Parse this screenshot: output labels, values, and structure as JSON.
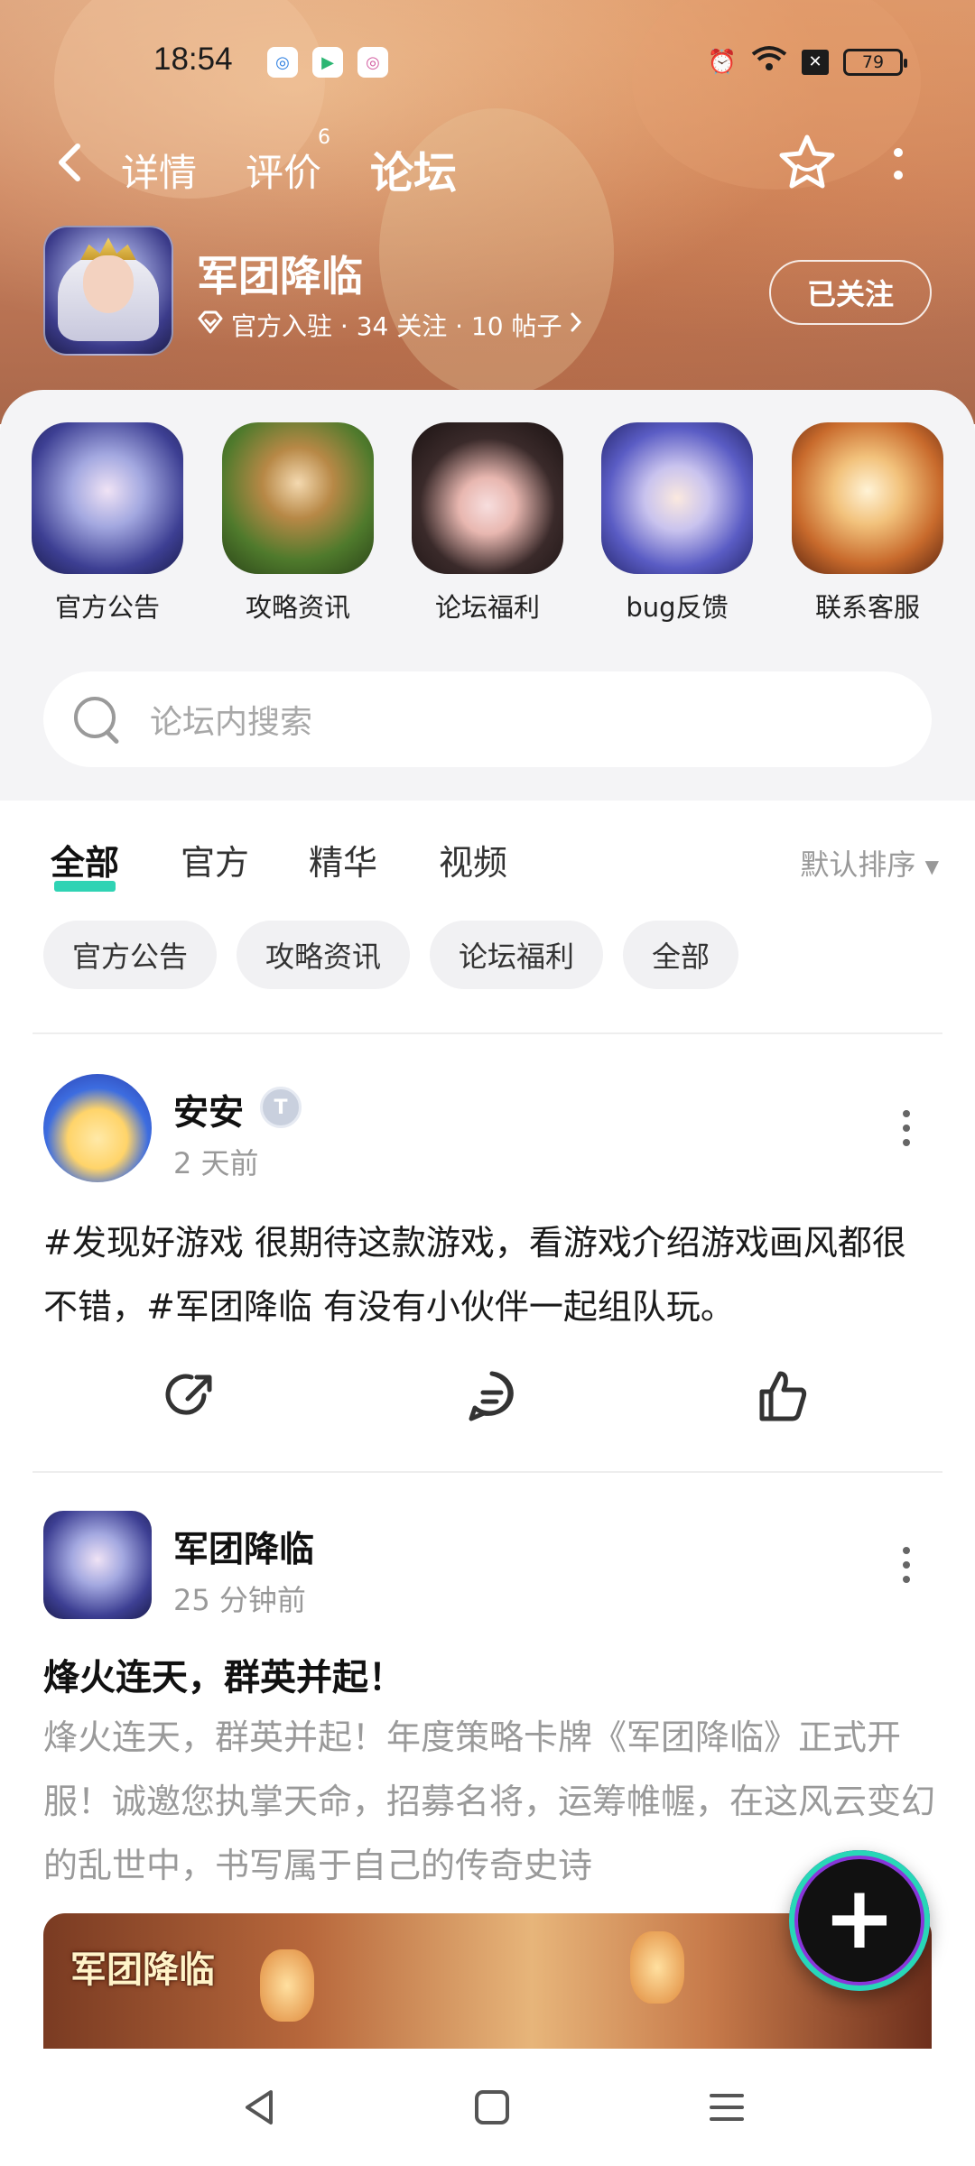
{
  "status_bar": {
    "time": "18:54",
    "battery": "79"
  },
  "nav": {
    "tabs": [
      {
        "label": "详情"
      },
      {
        "label": "评价",
        "badge": "6"
      },
      {
        "label": "论坛",
        "active": true
      }
    ]
  },
  "game": {
    "title": "军团降临",
    "meta": "官方入驻 · 34 关注 · 10 帖子",
    "follow_label": "已关注"
  },
  "shortcuts": [
    {
      "label": "官方公告"
    },
    {
      "label": "攻略资讯"
    },
    {
      "label": "论坛福利"
    },
    {
      "label": "bug反馈"
    },
    {
      "label": "联系客服"
    }
  ],
  "search": {
    "placeholder": "论坛内搜索"
  },
  "filter_tabs": [
    {
      "label": "全部",
      "active": true
    },
    {
      "label": "官方"
    },
    {
      "label": "精华"
    },
    {
      "label": "视频"
    }
  ],
  "sort_label": "默认排序",
  "chips": [
    "官方公告",
    "攻略资讯",
    "论坛福利",
    "全部"
  ],
  "posts": [
    {
      "author": "安安",
      "time": "2 天前",
      "text": "#发现好游戏 很期待这款游戏，看游戏介绍游戏画风都很不错，#军团降临 有没有小伙伴一起组队玩。"
    },
    {
      "author": "军团降临",
      "time": "25 分钟前",
      "title": "烽火连天，群英并起！",
      "text": "烽火连天，群英并起！年度策略卡牌《军团降临》正式开服！诚邀您执掌天命，招募名将，运筹帷幄，在这风云变幻的乱世中，书写属于自己的传奇史诗",
      "image_title": "军团降临"
    }
  ],
  "colors": {
    "accent": "#2fd3b4"
  }
}
